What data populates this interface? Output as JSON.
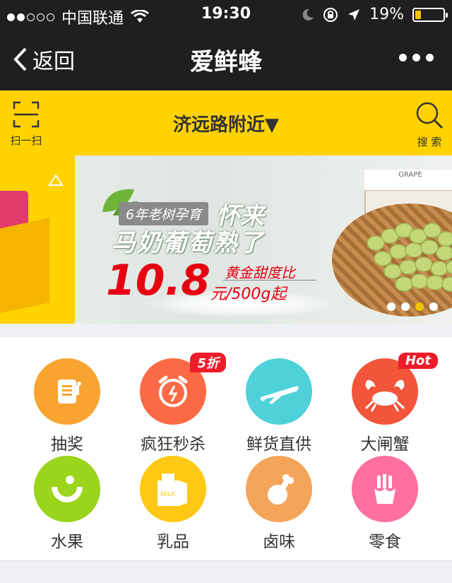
{
  "status_bar": {
    "carrier": "中国联通",
    "time": "19:30",
    "battery_percent": "19%",
    "battery_level": 0.19,
    "signal_bars": 2,
    "signal_total": 5
  },
  "nav": {
    "back_label": "返回",
    "title": "爱鲜蜂"
  },
  "location_bar": {
    "scan_label": "扫一扫",
    "location": "济远路附近▼",
    "search_label": "搜 索"
  },
  "banner": {
    "tag": "6年老树孕育",
    "headline1": "怀来",
    "headline2": "马奶葡萄熟了",
    "price": "10.8",
    "sweet": "黄金甜度比",
    "unit": "元/500g起",
    "box_text": "GRAPE",
    "slides": 4,
    "active_slide": 3
  },
  "categories": [
    {
      "label": "抽奖",
      "color": "#f9a431",
      "icon": "lottery-machine-icon"
    },
    {
      "label": "疯狂秒杀",
      "color": "#fb6a44",
      "icon": "alarm-clock-icon",
      "badge": "5折"
    },
    {
      "label": "鲜货直供",
      "color": "#4fd1d9",
      "icon": "airplane-icon"
    },
    {
      "label": "大闸蟹",
      "color": "#f2553a",
      "icon": "crab-icon",
      "badge": "Hot"
    },
    {
      "label": "水果",
      "color": "#9ad41b",
      "icon": "melon-icon"
    },
    {
      "label": "乳品",
      "color": "#ffc814",
      "icon": "milk-carton-icon",
      "icon_text": "MILK"
    },
    {
      "label": "卤味",
      "color": "#f5a55a",
      "icon": "drumstick-icon"
    },
    {
      "label": "零食",
      "color": "#ff6fa0",
      "icon": "fries-icon"
    }
  ]
}
